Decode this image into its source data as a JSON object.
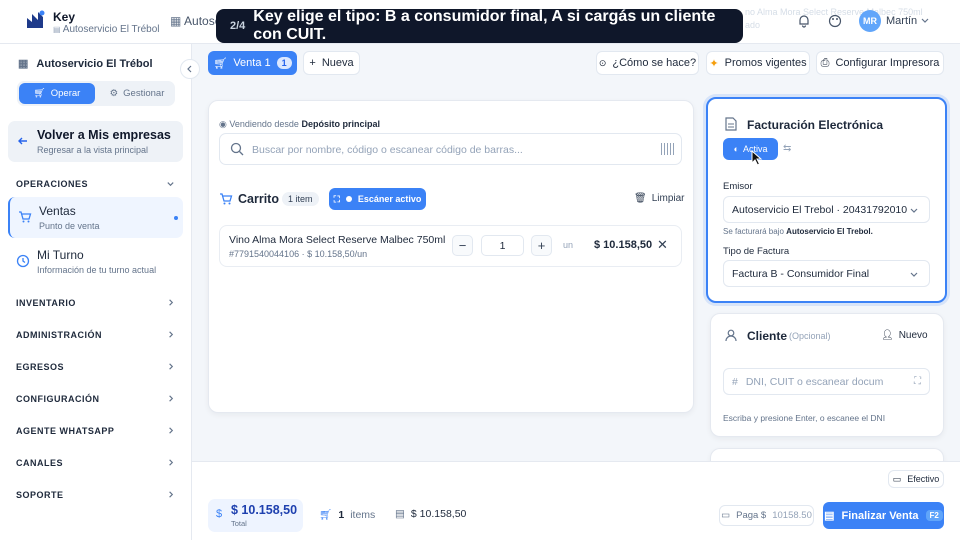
{
  "header": {
    "brand": "Key",
    "brand_sub": "Autoservicio El Trébol",
    "breadcrumb": "Autose",
    "ghost_line1": "no Alma Mora Select Reserve Malbec 750ml",
    "ghost_line2": "ado",
    "user_initials": "MR",
    "user_name": "Martín"
  },
  "tooltip": {
    "step": "2/4",
    "message": "Key elige el tipo: B a consumidor final, A si cargás un cliente con CUIT."
  },
  "sidebar": {
    "store": "Autoservicio El Trébol",
    "mode_operar": "Operar",
    "mode_gestionar": "Gestionar",
    "back_title": "Volver a Mis empresas",
    "back_sub": "Regresar a la vista principal",
    "section_operaciones": "OPERACIONES",
    "ventas_title": "Ventas",
    "ventas_sub": "Punto de venta",
    "turno_title": "Mi Turno",
    "turno_sub": "Información de tu turno actual",
    "sections": [
      "INVENTARIO",
      "ADMINISTRACIÓN",
      "EGRESOS",
      "CONFIGURACIÓN",
      "AGENTE WHATSAPP",
      "CANALES",
      "SOPORTE"
    ]
  },
  "toolbar": {
    "venta_tab": "Venta 1",
    "venta_count": "1",
    "nueva": "Nueva",
    "como": "¿Cómo se hace?",
    "promos": "Promos vigentes",
    "impresora": "Configurar Impresora"
  },
  "search": {
    "vendiendo": "Vendiendo desde",
    "deposito": "Depósito principal",
    "placeholder": "Buscar por nombre, código o escanear código de barras..."
  },
  "cart": {
    "title": "Carrito",
    "count": "1 item",
    "scanner": "Escáner activo",
    "clear": "Limpiar",
    "item": {
      "name": "Vino Alma Mora Select Reserve Malbec 750ml",
      "code": "#7791540044106",
      "unit_price": "$ 10.158,50/un",
      "qty": "1",
      "unit": "un",
      "total": "$ 10.158,50"
    }
  },
  "facturacion": {
    "title": "Facturación Electrónica",
    "status": "Activa",
    "emisor_label": "Emisor",
    "emisor": "Autoservicio El Trebol · 20431792010",
    "se_facturara": "Se facturará bajo",
    "se_facturara_name": "Autoservicio El Trebol.",
    "tipo_label": "Tipo de Factura",
    "tipo": "Factura B - Consumidor Final"
  },
  "cliente": {
    "title": "Cliente",
    "optional": "(Opcional)",
    "nuevo": "Nuevo",
    "placeholder": "DNI, CUIT o escanear docum",
    "hint": "Escriba y presione Enter, o escanee el DNI"
  },
  "footer": {
    "efectivo": "Efectivo",
    "total": "$ 10.158,50",
    "total_label": "Total",
    "items_count": "1",
    "items_label": "items",
    "subtotal": "$ 10.158,50",
    "paga_label": "Paga $",
    "paga_value": "10158.50",
    "finalizar": "Finalizar Venta",
    "finalizar_key": "F2"
  }
}
